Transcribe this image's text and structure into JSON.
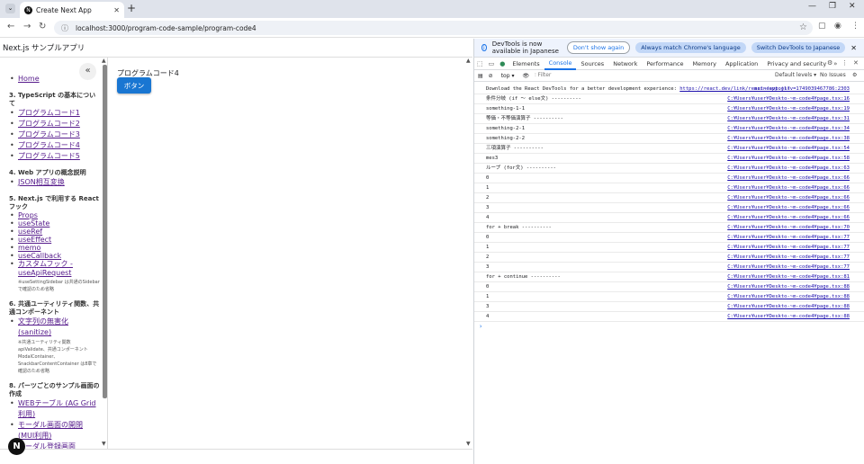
{
  "browser": {
    "tab_title": "Create Next App",
    "tab_favicon": "N",
    "new_tab": "+",
    "url": "localhost:3000/program-code-sample/program-code4"
  },
  "page": {
    "app_title": "Next.js サンプルアプリ",
    "program_title": "プログラムコード4",
    "button_label": "ボタン",
    "next_badge": "N"
  },
  "sidebar": {
    "home": "Home",
    "sections": [
      {
        "heading": "3. TypeScript の基本について",
        "items": [
          "プログラムコード1",
          "プログラムコード2",
          "プログラムコード3",
          "プログラムコード4",
          "プログラムコード5"
        ]
      },
      {
        "heading": "4. Web アプリの概念説明",
        "items": [
          "JSON相互変換"
        ]
      },
      {
        "heading": "5. Next.js で利用する React フック",
        "items": [
          "Props",
          "useState",
          "useRef",
          "useEffect",
          "memo",
          "useCallback",
          "カスタムフック - useApiRequest"
        ],
        "note": "※useSettingSidebar は共通のSidebarで確認のため省略"
      },
      {
        "heading": "6. 共通ユーティリティ関数、共通コンポーネント",
        "items": [
          "文字列の無害化 (sanitize)"
        ],
        "note": "※共通ユーティリティ関数 apiValidate、共通コンポーネント ModalContainer、SnackbarContentContainer は8章で確認のため省略"
      },
      {
        "heading": "8. パーツごとのサンプル画面の作成",
        "items": [
          "WEBテーブル (AG Grid利用)",
          "モーダル画面の開閉 (MUI利用)",
          "モーダル登録画面 (React"
        ]
      }
    ]
  },
  "devtools": {
    "infobar_text": "DevTools is now available in Japanese",
    "dont_show": "Don't show again",
    "match_lang": "Always match Chrome's language",
    "switch_lang": "Switch DevTools to Japanese",
    "tabs": [
      "Elements",
      "Console",
      "Sources",
      "Network",
      "Performance",
      "Memory",
      "Application",
      "Privacy and security"
    ],
    "context": "top ▾",
    "filter_placeholder": "Filter",
    "levels": "Default levels ▾",
    "issues": "No Issues",
    "first_line": {
      "text": "Download the React DevTools for a better development experience: ",
      "link": "https://react.dev/link/react-devtools",
      "src": "main-app.js?v=1749039467786:2303"
    },
    "logs": [
      {
        "msg": "条件分岐 (if 〜 else文) ----------",
        "src": "C:¥Users¥user¥Deskto-~m-code4¥page.tsx:16"
      },
      {
        "msg": "something-1-1",
        "src": "C:¥Users¥user¥Deskto-~m-code4¥page.tsx:19"
      },
      {
        "msg": "等価・不等価演算子 ----------",
        "src": "C:¥Users¥user¥Deskto-~m-code4¥page.tsx:31"
      },
      {
        "msg": "something-2-1",
        "src": "C:¥Users¥user¥Deskto-~m-code4¥page.tsx:34"
      },
      {
        "msg": "something-2-2",
        "src": "C:¥Users¥user¥Deskto-~m-code4¥page.tsx:38"
      },
      {
        "msg": "三項演算子 ----------",
        "src": "C:¥Users¥user¥Deskto-~m-code4¥page.tsx:54"
      },
      {
        "msg": "mes3",
        "src": "C:¥Users¥user¥Deskto-~m-code4¥page.tsx:58"
      },
      {
        "msg": "ループ (for文) ----------",
        "src": "C:¥Users¥user¥Deskto-~m-code4¥page.tsx:63"
      },
      {
        "msg": "0",
        "src": "C:¥Users¥user¥Deskto-~m-code4¥page.tsx:66"
      },
      {
        "msg": "1",
        "src": "C:¥Users¥user¥Deskto-~m-code4¥page.tsx:66"
      },
      {
        "msg": "2",
        "src": "C:¥Users¥user¥Deskto-~m-code4¥page.tsx:66"
      },
      {
        "msg": "3",
        "src": "C:¥Users¥user¥Deskto-~m-code4¥page.tsx:66"
      },
      {
        "msg": "4",
        "src": "C:¥Users¥user¥Deskto-~m-code4¥page.tsx:66"
      },
      {
        "msg": "for + break ----------",
        "src": "C:¥Users¥user¥Deskto-~m-code4¥page.tsx:70"
      },
      {
        "msg": "0",
        "src": "C:¥Users¥user¥Deskto-~m-code4¥page.tsx:77"
      },
      {
        "msg": "1",
        "src": "C:¥Users¥user¥Deskto-~m-code4¥page.tsx:77"
      },
      {
        "msg": "2",
        "src": "C:¥Users¥user¥Deskto-~m-code4¥page.tsx:77"
      },
      {
        "msg": "3",
        "src": "C:¥Users¥user¥Deskto-~m-code4¥page.tsx:77"
      },
      {
        "msg": "for + continue ----------",
        "src": "C:¥Users¥user¥Deskto-~m-code4¥page.tsx:81"
      },
      {
        "msg": "0",
        "src": "C:¥Users¥user¥Deskto-~m-code4¥page.tsx:88"
      },
      {
        "msg": "1",
        "src": "C:¥Users¥user¥Deskto-~m-code4¥page.tsx:88"
      },
      {
        "msg": "3",
        "src": "C:¥Users¥user¥Deskto-~m-code4¥page.tsx:88"
      },
      {
        "msg": "4",
        "src": "C:¥Users¥user¥Deskto-~m-code4¥page.tsx:88"
      }
    ],
    "prompt": "›"
  },
  "colors": {
    "accent": "#1a73e8",
    "button": "#1976d2",
    "link_visited": "#551a8b"
  }
}
